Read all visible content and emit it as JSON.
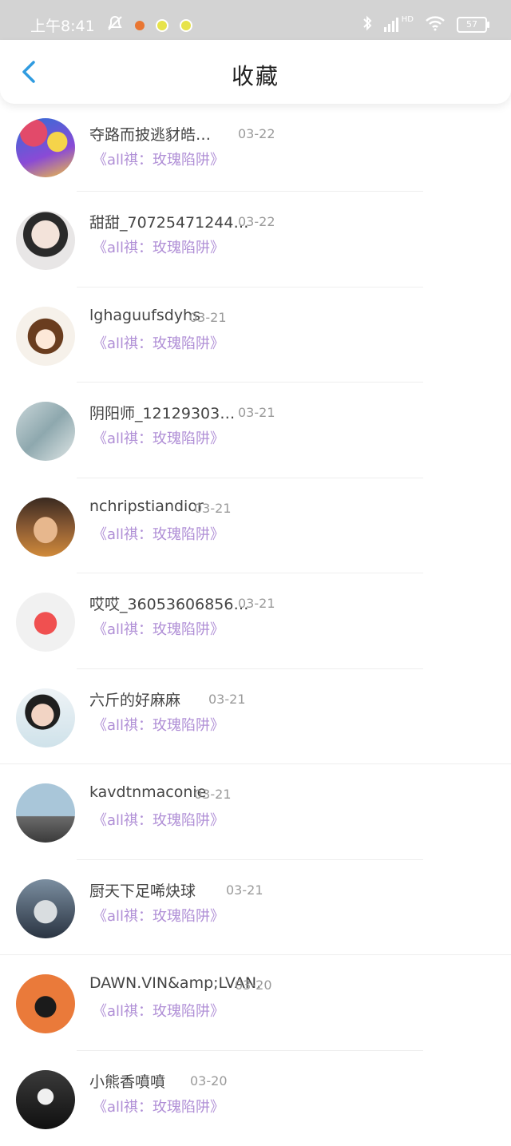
{
  "status_bar": {
    "time": "上午8:41",
    "battery": "57",
    "network": "HD"
  },
  "header": {
    "title": "收藏"
  },
  "favorites": [
    {
      "name": "夺路而披逃豺皓…",
      "date": "03-22",
      "post": "《all祺：玫瑰陷阱》"
    },
    {
      "name": "甜甜_70725471244…",
      "date": "03-22",
      "post": "《all祺：玫瑰陷阱》"
    },
    {
      "name": "lghaguufsdyhs",
      "date": "03-21",
      "post": "《all祺：玫瑰陷阱》"
    },
    {
      "name": "阴阳师_12129303…",
      "date": "03-21",
      "post": "《all祺：玫瑰陷阱》"
    },
    {
      "name": "nchripstiandior",
      "date": "03-21",
      "post": "《all祺：玫瑰陷阱》"
    },
    {
      "name": "哎哎_36053606856…",
      "date": "03-21",
      "post": "《all祺：玫瑰陷阱》"
    },
    {
      "name": "六斤的好麻麻",
      "date": "03-21",
      "post": "《all祺：玫瑰陷阱》"
    },
    {
      "name": "kavdtnmaconie",
      "date": "03-21",
      "post": "《all祺：玫瑰陷阱》"
    },
    {
      "name": "厨天下足唏炔球",
      "date": "03-21",
      "post": "《all祺：玫瑰陷阱》"
    },
    {
      "name": "DAWN.VIN&amp;LVAN.",
      "date": "03-20",
      "post": "《all祺：玫瑰陷阱》"
    },
    {
      "name": "小熊香噴噴",
      "date": "03-20",
      "post": "《all祺：玫瑰陷阱》"
    }
  ],
  "colors": {
    "status_bar": "#d3d3d3",
    "back_arrow": "#2f9be0",
    "post_link": "#b08fd6",
    "date": "#9a9a9a"
  },
  "icons": {
    "back": "back-arrow-icon",
    "mute": "mute-icon",
    "bluetooth": "bluetooth-icon",
    "signal": "signal-icon",
    "wifi": "wifi-icon",
    "battery": "battery-icon"
  }
}
